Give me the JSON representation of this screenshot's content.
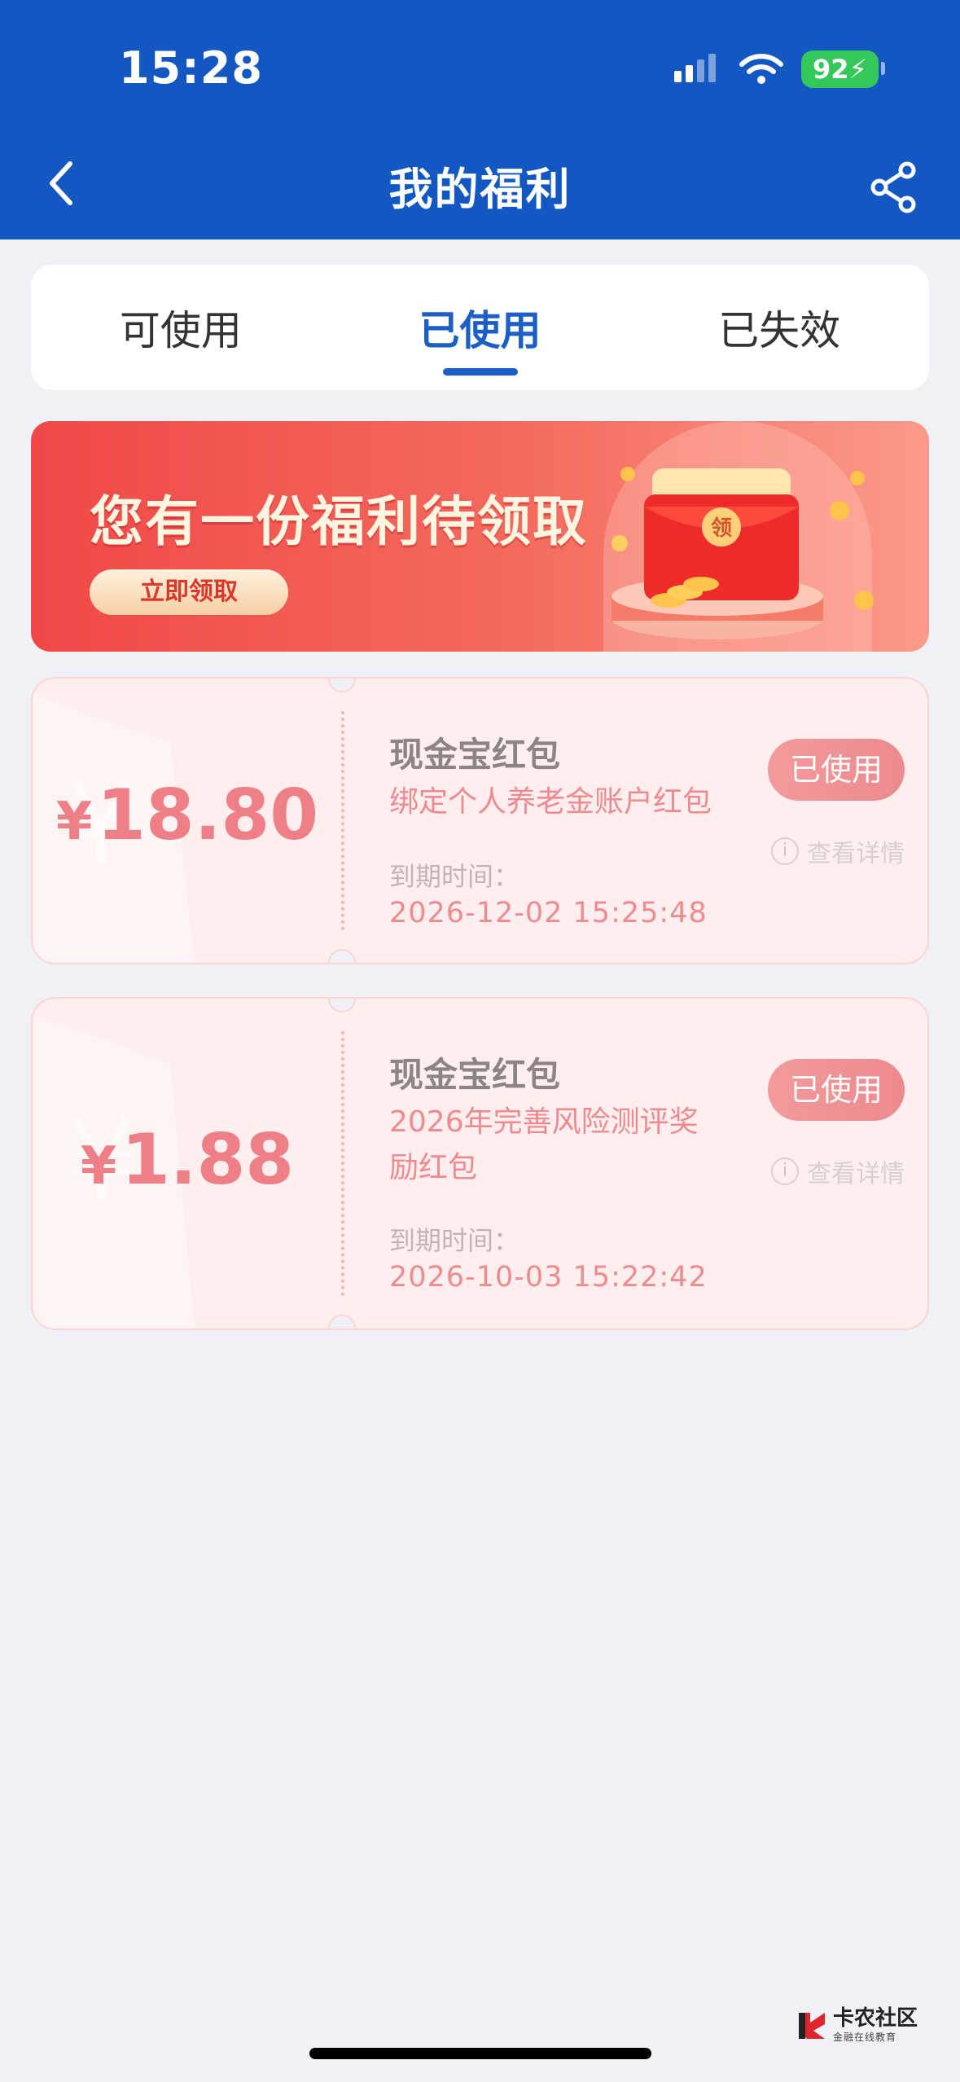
{
  "status": {
    "time": "15:28",
    "battery": "92"
  },
  "nav": {
    "title": "我的福利"
  },
  "tabs": [
    {
      "label": "可使用",
      "active": false
    },
    {
      "label": "已使用",
      "active": true
    },
    {
      "label": "已失效",
      "active": false
    }
  ],
  "banner": {
    "title": "您有一份福利待领取",
    "button": "立即领取",
    "envelope_char": "领"
  },
  "coupons": [
    {
      "symbol": "¥",
      "amount": "18.80",
      "title": "现金宝红包",
      "desc": "绑定个人养老金账户红包",
      "exp_label": "到期时间：",
      "exp": "2026-12-02 15:25:48",
      "badge": "已使用",
      "detail": "查看详情"
    },
    {
      "symbol": "¥",
      "amount": "1.88",
      "title": "现金宝红包",
      "desc": "2026年完善风险测评奖励红包",
      "exp_label": "到期时间：",
      "exp": "2026-10-03 15:22:42",
      "badge": "已使用",
      "detail": "查看详情"
    }
  ],
  "watermark": {
    "main": "卡农社区",
    "sub": "金融在线教育"
  },
  "colors": {
    "header": "#1257c2",
    "accent": "#1a5ec6",
    "coupon_red": "#ee7f86"
  }
}
